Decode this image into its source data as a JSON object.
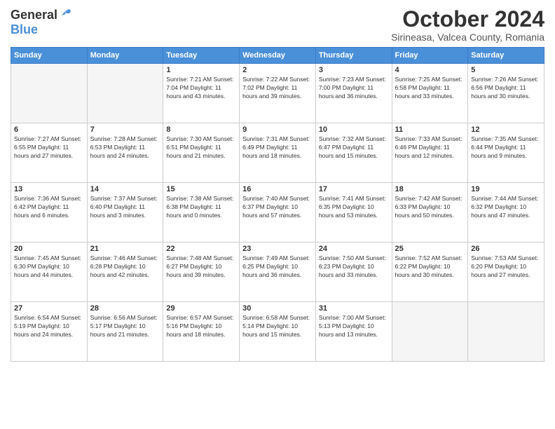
{
  "header": {
    "logo": {
      "general": "General",
      "blue": "Blue"
    },
    "title": "October 2024",
    "subtitle": "Sirineasa, Valcea County, Romania"
  },
  "days_of_week": [
    "Sunday",
    "Monday",
    "Tuesday",
    "Wednesday",
    "Thursday",
    "Friday",
    "Saturday"
  ],
  "weeks": [
    [
      {
        "day": "",
        "info": ""
      },
      {
        "day": "",
        "info": ""
      },
      {
        "day": "1",
        "info": "Sunrise: 7:21 AM\nSunset: 7:04 PM\nDaylight: 11 hours and 43 minutes."
      },
      {
        "day": "2",
        "info": "Sunrise: 7:22 AM\nSunset: 7:02 PM\nDaylight: 11 hours and 39 minutes."
      },
      {
        "day": "3",
        "info": "Sunrise: 7:23 AM\nSunset: 7:00 PM\nDaylight: 11 hours and 36 minutes."
      },
      {
        "day": "4",
        "info": "Sunrise: 7:25 AM\nSunset: 6:58 PM\nDaylight: 11 hours and 33 minutes."
      },
      {
        "day": "5",
        "info": "Sunrise: 7:26 AM\nSunset: 6:56 PM\nDaylight: 11 hours and 30 minutes."
      }
    ],
    [
      {
        "day": "6",
        "info": "Sunrise: 7:27 AM\nSunset: 6:55 PM\nDaylight: 11 hours and 27 minutes."
      },
      {
        "day": "7",
        "info": "Sunrise: 7:28 AM\nSunset: 6:53 PM\nDaylight: 11 hours and 24 minutes."
      },
      {
        "day": "8",
        "info": "Sunrise: 7:30 AM\nSunset: 6:51 PM\nDaylight: 11 hours and 21 minutes."
      },
      {
        "day": "9",
        "info": "Sunrise: 7:31 AM\nSunset: 6:49 PM\nDaylight: 11 hours and 18 minutes."
      },
      {
        "day": "10",
        "info": "Sunrise: 7:32 AM\nSunset: 6:47 PM\nDaylight: 11 hours and 15 minutes."
      },
      {
        "day": "11",
        "info": "Sunrise: 7:33 AM\nSunset: 6:46 PM\nDaylight: 11 hours and 12 minutes."
      },
      {
        "day": "12",
        "info": "Sunrise: 7:35 AM\nSunset: 6:44 PM\nDaylight: 11 hours and 9 minutes."
      }
    ],
    [
      {
        "day": "13",
        "info": "Sunrise: 7:36 AM\nSunset: 6:42 PM\nDaylight: 11 hours and 6 minutes."
      },
      {
        "day": "14",
        "info": "Sunrise: 7:37 AM\nSunset: 6:40 PM\nDaylight: 11 hours and 3 minutes."
      },
      {
        "day": "15",
        "info": "Sunrise: 7:38 AM\nSunset: 6:38 PM\nDaylight: 11 hours and 0 minutes."
      },
      {
        "day": "16",
        "info": "Sunrise: 7:40 AM\nSunset: 6:37 PM\nDaylight: 10 hours and 57 minutes."
      },
      {
        "day": "17",
        "info": "Sunrise: 7:41 AM\nSunset: 6:35 PM\nDaylight: 10 hours and 53 minutes."
      },
      {
        "day": "18",
        "info": "Sunrise: 7:42 AM\nSunset: 6:33 PM\nDaylight: 10 hours and 50 minutes."
      },
      {
        "day": "19",
        "info": "Sunrise: 7:44 AM\nSunset: 6:32 PM\nDaylight: 10 hours and 47 minutes."
      }
    ],
    [
      {
        "day": "20",
        "info": "Sunrise: 7:45 AM\nSunset: 6:30 PM\nDaylight: 10 hours and 44 minutes."
      },
      {
        "day": "21",
        "info": "Sunrise: 7:46 AM\nSunset: 6:28 PM\nDaylight: 10 hours and 42 minutes."
      },
      {
        "day": "22",
        "info": "Sunrise: 7:48 AM\nSunset: 6:27 PM\nDaylight: 10 hours and 39 minutes."
      },
      {
        "day": "23",
        "info": "Sunrise: 7:49 AM\nSunset: 6:25 PM\nDaylight: 10 hours and 36 minutes."
      },
      {
        "day": "24",
        "info": "Sunrise: 7:50 AM\nSunset: 6:23 PM\nDaylight: 10 hours and 33 minutes."
      },
      {
        "day": "25",
        "info": "Sunrise: 7:52 AM\nSunset: 6:22 PM\nDaylight: 10 hours and 30 minutes."
      },
      {
        "day": "26",
        "info": "Sunrise: 7:53 AM\nSunset: 6:20 PM\nDaylight: 10 hours and 27 minutes."
      }
    ],
    [
      {
        "day": "27",
        "info": "Sunrise: 6:54 AM\nSunset: 5:19 PM\nDaylight: 10 hours and 24 minutes."
      },
      {
        "day": "28",
        "info": "Sunrise: 6:56 AM\nSunset: 5:17 PM\nDaylight: 10 hours and 21 minutes."
      },
      {
        "day": "29",
        "info": "Sunrise: 6:57 AM\nSunset: 5:16 PM\nDaylight: 10 hours and 18 minutes."
      },
      {
        "day": "30",
        "info": "Sunrise: 6:58 AM\nSunset: 5:14 PM\nDaylight: 10 hours and 15 minutes."
      },
      {
        "day": "31",
        "info": "Sunrise: 7:00 AM\nSunset: 5:13 PM\nDaylight: 10 hours and 13 minutes."
      },
      {
        "day": "",
        "info": ""
      },
      {
        "day": "",
        "info": ""
      }
    ]
  ]
}
